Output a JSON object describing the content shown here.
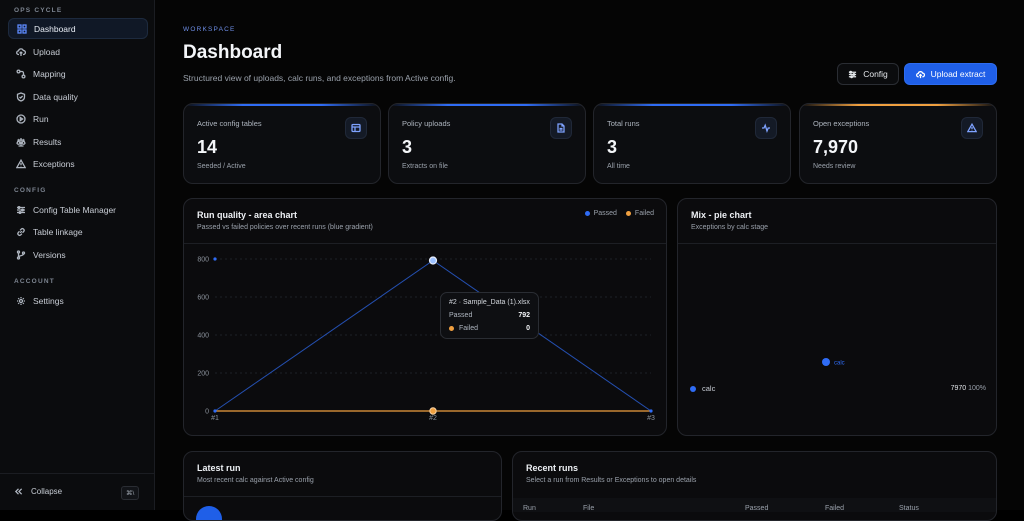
{
  "sidebar": {
    "sections": {
      "ops_cycle": "OPS CYCLE",
      "config": "CONFIG",
      "account": "ACCOUNT"
    },
    "items": [
      {
        "label": "Dashboard",
        "icon": "grid-icon"
      },
      {
        "label": "Upload",
        "icon": "cloud-upload-icon"
      },
      {
        "label": "Mapping",
        "icon": "mapping-icon"
      },
      {
        "label": "Data quality",
        "icon": "shield-check-icon"
      },
      {
        "label": "Run",
        "icon": "play-circle-icon"
      },
      {
        "label": "Results",
        "icon": "scale-icon"
      },
      {
        "label": "Exceptions",
        "icon": "warning-icon"
      },
      {
        "label": "Config Table Manager",
        "icon": "sliders-icon"
      },
      {
        "label": "Table linkage",
        "icon": "link-icon"
      },
      {
        "label": "Versions",
        "icon": "branch-icon"
      },
      {
        "label": "Settings",
        "icon": "gear-icon"
      }
    ],
    "collapse_label": "Collapse",
    "collapse_shortcut": "⌘\\"
  },
  "header": {
    "eyebrow": "WORKSPACE",
    "title": "Dashboard",
    "subtitle": "Structured view of uploads, calc runs, and exceptions from Active config.",
    "config_button": "Config",
    "upload_button": "Upload extract"
  },
  "kpis": [
    {
      "label": "Active config tables",
      "value": "14",
      "sub": "Seeded / Active",
      "icon": "table-icon",
      "accent": "#2f6cf5"
    },
    {
      "label": "Policy uploads",
      "value": "3",
      "sub": "Extracts on file",
      "icon": "file-icon",
      "accent": "#2f6cf5"
    },
    {
      "label": "Total runs",
      "value": "3",
      "sub": "All time",
      "icon": "activity-icon",
      "accent": "#2f6cf5"
    },
    {
      "label": "Open exceptions",
      "value": "7,970",
      "sub": "Needs review",
      "icon": "alert-triangle-icon",
      "accent": "#f0a040"
    }
  ],
  "area_panel": {
    "title": "Run quality - area chart",
    "subtitle": "Passed vs failed policies over recent runs (blue gradient)",
    "legend": [
      "Passed",
      "Failed"
    ],
    "tooltip": {
      "title": "#2 · Sample_Data (1).xlsx",
      "passed_label": "Passed",
      "passed_value": "792",
      "failed_label": "Failed",
      "failed_value": "0"
    }
  },
  "pie_panel": {
    "title": "Mix - pie chart",
    "subtitle": "Exceptions by calc stage",
    "slice_label": "calc",
    "legend_label": "calc",
    "legend_value": "7970",
    "legend_pct": "100%"
  },
  "latest_run": {
    "title": "Latest run",
    "subtitle": "Most recent calc against Active config"
  },
  "recent_runs": {
    "title": "Recent runs",
    "subtitle": "Select a run from Results or Exceptions to open details",
    "columns": [
      "Run",
      "File",
      "Passed",
      "Failed",
      "Status"
    ]
  },
  "colors": {
    "passed": "#2f6cf5",
    "failed": "#f0a040"
  },
  "chart_data": [
    {
      "type": "area",
      "title": "Run quality - area chart",
      "x": [
        "#1",
        "#2",
        "#3"
      ],
      "series": [
        {
          "name": "Passed",
          "values": [
            0,
            792,
            0
          ]
        },
        {
          "name": "Failed",
          "values": [
            0,
            0,
            0
          ]
        }
      ],
      "yticks": [
        0,
        200,
        400,
        600,
        800
      ],
      "ylim": [
        0,
        800
      ],
      "grid": true,
      "legend": "top-right"
    },
    {
      "type": "pie",
      "title": "Mix - pie chart",
      "categories": [
        "calc"
      ],
      "values": [
        7970
      ]
    }
  ]
}
